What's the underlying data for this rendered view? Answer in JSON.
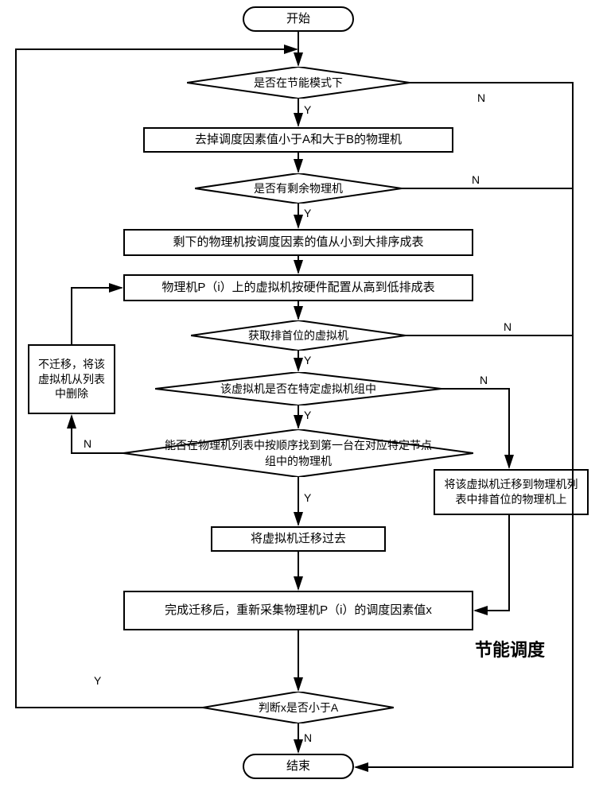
{
  "title": "节能调度",
  "nodes": {
    "start": "开始",
    "d1": "是否在节能模式下",
    "p1": "去掉调度因素值小于A和大于B的物理机",
    "d2": "是否有剩余物理机",
    "p2": "剩下的物理机按调度因素的值从小到大排序成表",
    "p3": "物理机P（i）上的虚拟机按硬件配置从高到低排成表",
    "d3": "获取排首位的虚拟机",
    "d4": "该虚拟机是否在特定虚拟机组中",
    "d5": "能否在物理机列表中按顺序找到第一台在对应特定节点组中的物理机",
    "side": "不迁移，将该虚拟机从列表中删除",
    "p4": "将虚拟机迁移过去",
    "p5": "将该虚拟机迁移到物理机列表中排首位的物理机上",
    "p6": "完成迁移后，重新采集物理机P（i）的调度因素值x",
    "d6": "判断x是否小于A",
    "end": "结束"
  },
  "labels": {
    "yes": "Y",
    "no": "N"
  }
}
